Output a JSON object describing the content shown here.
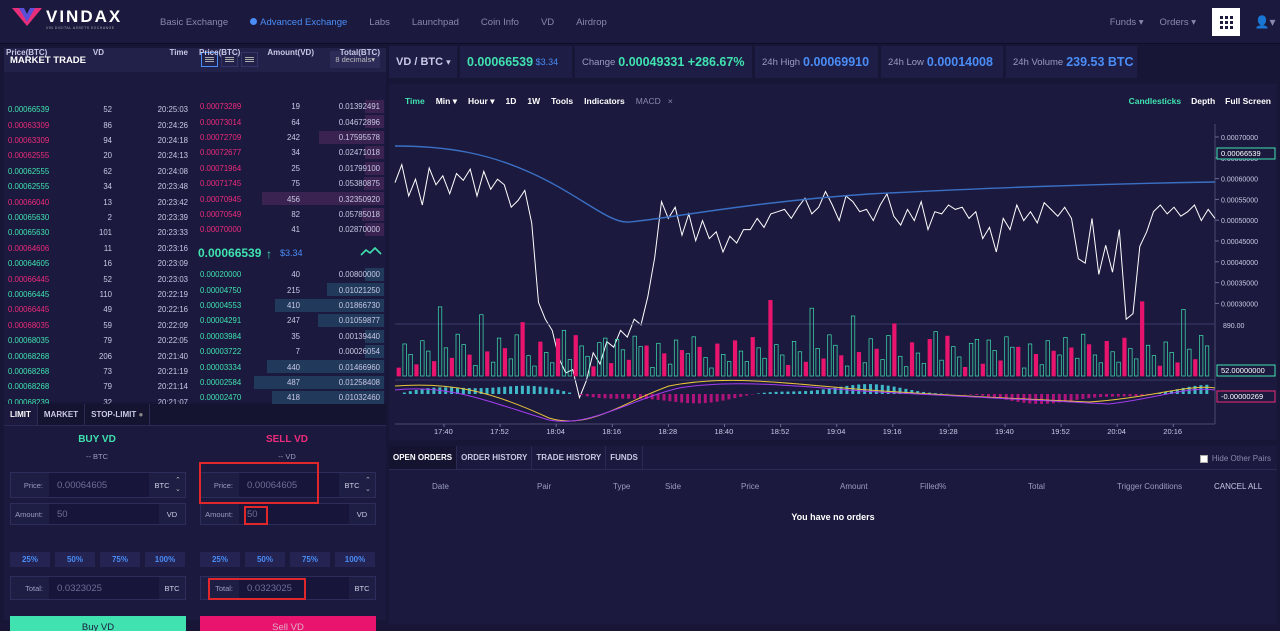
{
  "nav": {
    "brand": "VINDAX",
    "tagline": "VIN DIGITAL ASSETS EXCHANGE",
    "links": [
      "Basic Exchange",
      "Advanced Exchange",
      "Labs",
      "Launchpad",
      "Coin Info",
      "VD",
      "Airdrop"
    ],
    "active": 1,
    "funds": "Funds",
    "orders": "Orders"
  },
  "market": {
    "title": "MARKET TRADE",
    "decimals": "8 decimals",
    "trade_headers": [
      "Price(BTC)",
      "VD",
      "Time"
    ],
    "book_headers": [
      "Price(BTC)",
      "Amount(VD)",
      "Total(BTC)"
    ],
    "trades": [
      [
        "0.00066539",
        "52",
        "20:25:03",
        "g"
      ],
      [
        "0.00063309",
        "86",
        "20:24:26",
        "r"
      ],
      [
        "0.00063309",
        "94",
        "20:24:18",
        "r"
      ],
      [
        "0.00062555",
        "20",
        "20:24:13",
        "r"
      ],
      [
        "0.00062555",
        "62",
        "20:24:08",
        "g"
      ],
      [
        "0.00062555",
        "34",
        "20:23:48",
        "g"
      ],
      [
        "0.00066040",
        "13",
        "20:23:42",
        "r"
      ],
      [
        "0.00065630",
        "2",
        "20:23:39",
        "g"
      ],
      [
        "0.00065630",
        "101",
        "20:23:33",
        "g"
      ],
      [
        "0.00064606",
        "11",
        "20:23:16",
        "r"
      ],
      [
        "0.00064605",
        "16",
        "20:23:09",
        "g"
      ],
      [
        "0.00066445",
        "52",
        "20:23:03",
        "r"
      ],
      [
        "0.00066445",
        "110",
        "20:22:19",
        "g"
      ],
      [
        "0.00066445",
        "49",
        "20:22:16",
        "r"
      ],
      [
        "0.00068035",
        "59",
        "20:22:09",
        "r"
      ],
      [
        "0.00068035",
        "79",
        "20:22:05",
        "g"
      ],
      [
        "0.00068268",
        "206",
        "20:21:40",
        "g"
      ],
      [
        "0.00068268",
        "73",
        "20:21:19",
        "g"
      ],
      [
        "0.00068268",
        "79",
        "20:21:14",
        "g"
      ],
      [
        "0.00068239",
        "32",
        "20:21:07",
        "g"
      ]
    ],
    "asks": [
      [
        "0.00073289",
        "19",
        "0.01392491"
      ],
      [
        "0.00073014",
        "64",
        "0.04672896"
      ],
      [
        "0.00072709",
        "242",
        "0.17595578"
      ],
      [
        "0.00072677",
        "34",
        "0.02471018"
      ],
      [
        "0.00071964",
        "25",
        "0.01799100"
      ],
      [
        "0.00071745",
        "75",
        "0.05380875"
      ],
      [
        "0.00070945",
        "456",
        "0.32350920"
      ],
      [
        "0.00070549",
        "82",
        "0.05785018"
      ],
      [
        "0.00070000",
        "41",
        "0.02870000"
      ]
    ],
    "last_price": "0.00066539",
    "last_usd": "$3.34",
    "bids": [
      [
        "0.00020000",
        "40",
        "0.00800000"
      ],
      [
        "0.00004750",
        "215",
        "0.01021250"
      ],
      [
        "0.00004553",
        "410",
        "0.01866730"
      ],
      [
        "0.00004291",
        "247",
        "0.01059877"
      ],
      [
        "0.00003984",
        "35",
        "0.00139440"
      ],
      [
        "0.00003722",
        "7",
        "0.00026054"
      ],
      [
        "0.00003334",
        "440",
        "0.01466960"
      ],
      [
        "0.00002584",
        "487",
        "0.01258408"
      ],
      [
        "0.00002470",
        "418",
        "0.01032460"
      ]
    ]
  },
  "form": {
    "tabs": [
      "LIMIT",
      "MARKET",
      "STOP-LIMIT"
    ],
    "buy": {
      "title": "BUY VD",
      "sub": "-- BTC",
      "price_label": "Price:",
      "price": "0.00064605",
      "price_cur": "BTC",
      "amount_label": "Amount:",
      "amount": "50",
      "amount_cur": "VD",
      "total_label": "Total:",
      "total": "0.0323025",
      "total_cur": "BTC",
      "button": "Buy VD"
    },
    "sell": {
      "title": "SELL VD",
      "sub": "-- VD",
      "price_label": "Price:",
      "price": "0.00064605",
      "price_cur": "BTC",
      "amount_label": "Amount:",
      "amount": "50",
      "amount_cur": "VD",
      "total_label": "Total:",
      "total": "0.0323025",
      "total_cur": "BTC",
      "button": "Sell VD"
    },
    "pcts": [
      "25%",
      "50%",
      "75%",
      "100%"
    ]
  },
  "ticker": {
    "pair": "VD / BTC",
    "price": "0.00066539",
    "usd": "$3.34",
    "change_label": "Change",
    "change": "0.00049331 +286.67%",
    "high_label": "24h High",
    "high": "0.00069910",
    "low_label": "24h Low",
    "low": "0.00014008",
    "vol_label": "24h Volume",
    "vol": "239.53 BTC"
  },
  "chart": {
    "tools_left": [
      "Time",
      "Min",
      "Hour",
      "1D",
      "1W",
      "Tools",
      "Indicators",
      "MACD",
      "×"
    ],
    "tools_right": [
      "Candlesticks",
      "Depth",
      "Full Screen"
    ],
    "price_ticks": [
      "0.00070000",
      "0.00065000",
      "0.00060000",
      "0.00055000",
      "0.00050000",
      "0.00045000",
      "0.00040000",
      "0.00035000",
      "0.00030000"
    ],
    "price_tag": "0.00066539",
    "vol_max": "890.00",
    "vol_tag": "52.00000000",
    "macd_tag": "-0.00000269",
    "time_ticks": [
      "17:40",
      "17:52",
      "18:04",
      "18:16",
      "18:28",
      "18:40",
      "18:52",
      "19:04",
      "19:16",
      "19:28",
      "19:40",
      "19:52",
      "20:04",
      "20:16"
    ]
  },
  "orders": {
    "tabs": [
      "OPEN ORDERS",
      "ORDER HISTORY",
      "TRADE HISTORY",
      "FUNDS"
    ],
    "hide": "Hide Other Pairs",
    "cols": [
      "Date",
      "Pair",
      "Type",
      "Side",
      "Price",
      "Amount",
      "Filled%",
      "Total",
      "Trigger Conditions",
      "CANCEL ALL"
    ],
    "empty": "You have no orders"
  }
}
